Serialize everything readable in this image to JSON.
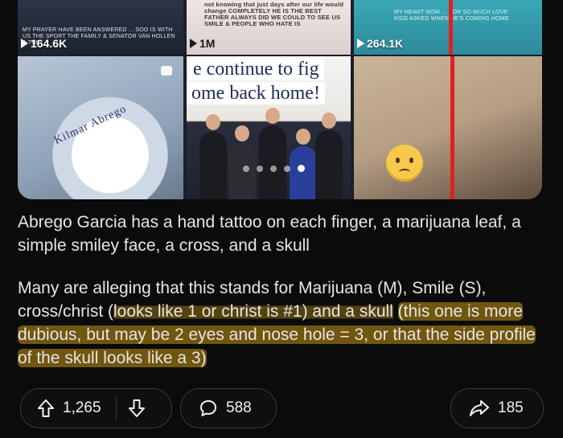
{
  "post": {
    "carousel": {
      "tile1": {
        "caption": "MY PRAYER HAVE BEEN ANSWERED ... SOO IS WITH US THE SPORT THE FAMILY & SENATOR VAN HOLLEN & THE",
        "views": "164.6K"
      },
      "tile2": {
        "caption": "not knowing that just days after our life would change COMPLETELY HE IS THE BEST FATHER ALWAYS DID WE COULD TO SEE US SMILE & PEOPLE WHO HATE IS",
        "views": "1M"
      },
      "tile3": {
        "caption": "MY HEART NOW ... FOR SO MUCH LOVE KIDS ASKED WHEN HE'S COMING HOME",
        "views": "264.1K"
      },
      "tile5": {
        "banner1": "e continue to fig",
        "banner2": "ome back home!"
      },
      "tile4": {
        "shirt_text": "Kilmar Abrego"
      },
      "active_index": 3,
      "dot_count": 5
    },
    "paragraph1": "Abrego Garcia has a hand tattoo on each finger, a marijuana leaf, a simple smiley face, a cross, and a skull",
    "paragraph2": {
      "part_plain": "Many are alleging that this stands for Marijuana (M), Smile (S), cross/christ (",
      "part_hl1": "looks like 1 or christ is #1) and a skull",
      "part_hl2": "(this one is more dubious, but may be 2 eyes and nose hole = 3, or that the side profile of the skull looks like a 3)"
    }
  },
  "actions": {
    "upvotes": "1,265",
    "comments": "588",
    "shares": "185"
  },
  "colors": {
    "background": "#0b0b0b",
    "highlight": "#c49614"
  }
}
